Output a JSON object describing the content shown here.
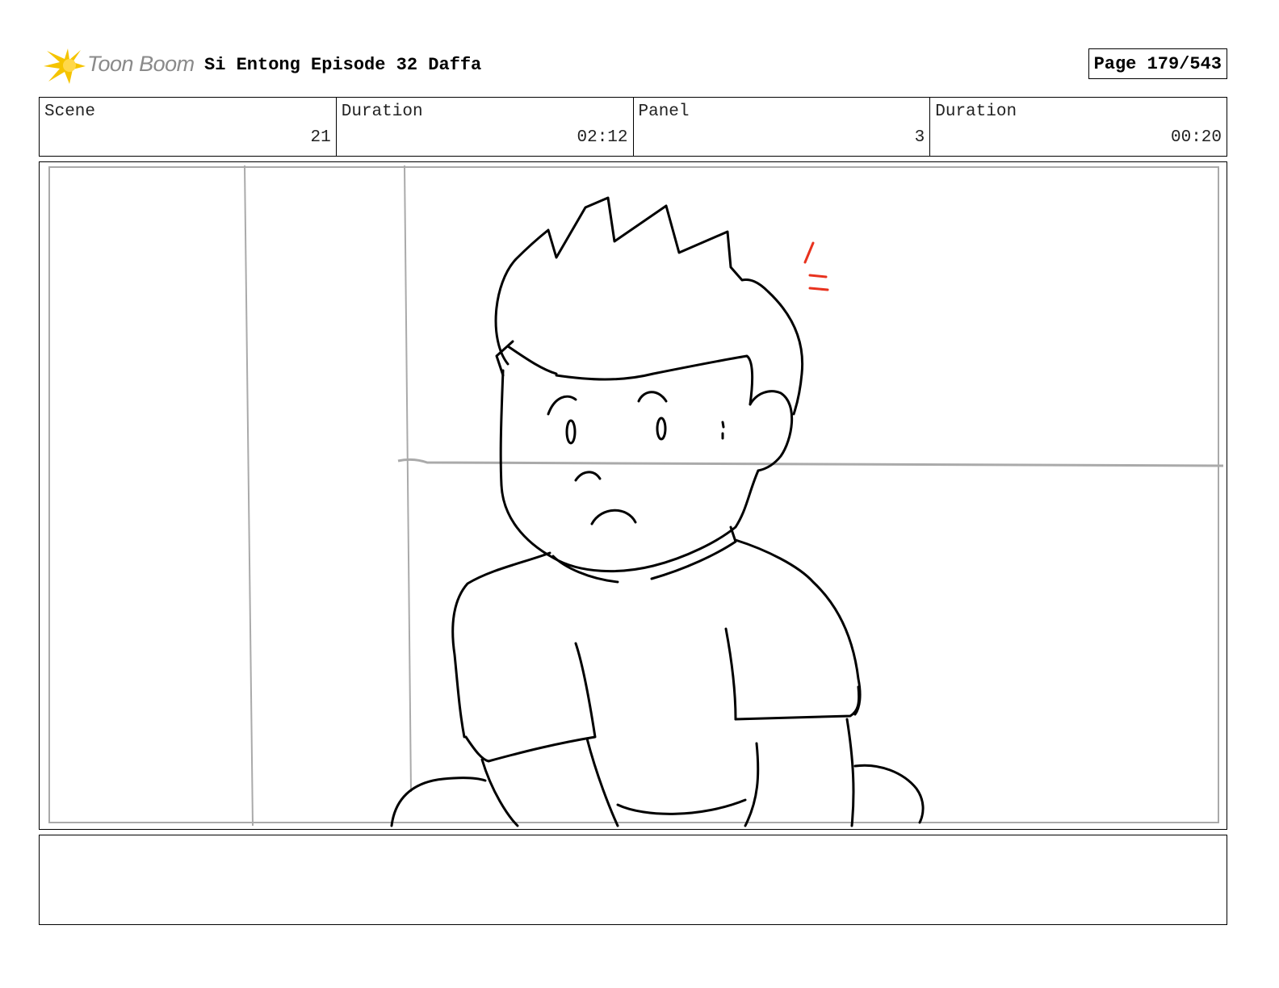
{
  "header": {
    "logo_text": "Toon Boom",
    "title": "Si Entong Episode 32 Daffa",
    "page": "Page 179/543"
  },
  "info": {
    "scene_label": "Scene",
    "scene_value": "21",
    "scene_duration_label": "Duration",
    "scene_duration_value": "02:12",
    "panel_label": "Panel",
    "panel_value": "3",
    "panel_duration_label": "Duration",
    "panel_duration_value": "00:20"
  },
  "colors": {
    "logo_yellow": "#f5c400",
    "logo_text": "#8a8a8a",
    "sketch_line": "#000000",
    "guide_line": "#aaaaaa",
    "accent_red": "#e8321e"
  },
  "notes": ""
}
